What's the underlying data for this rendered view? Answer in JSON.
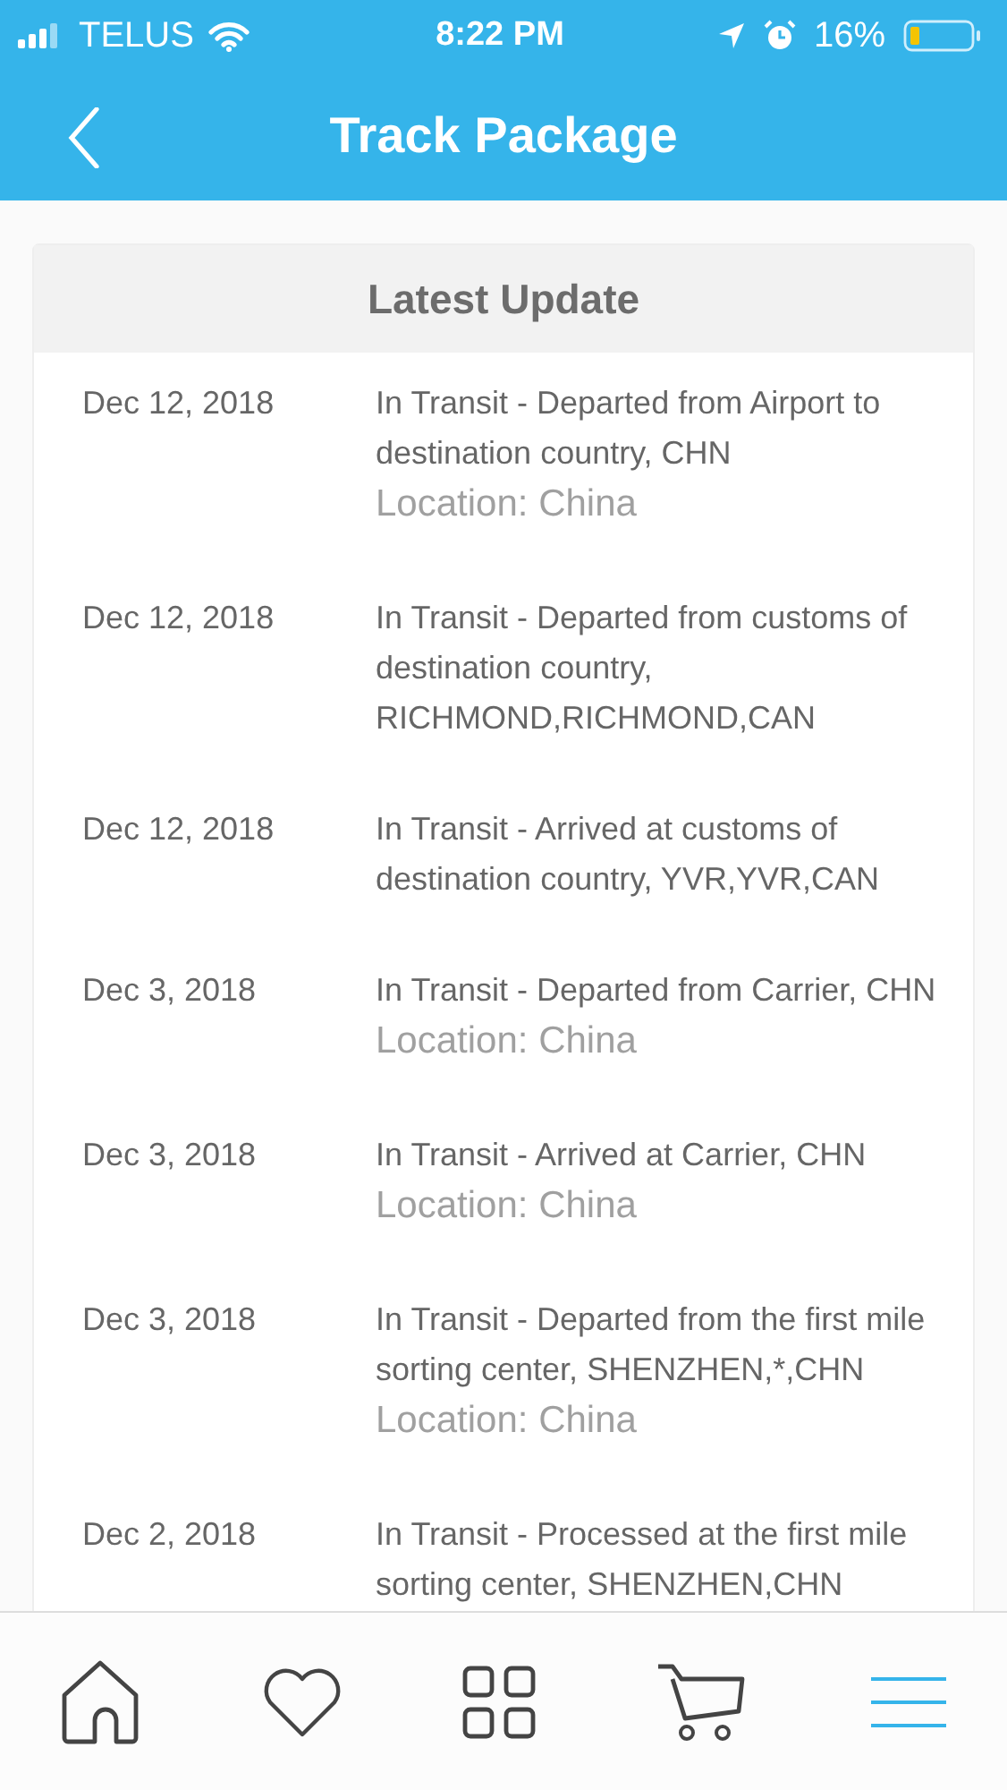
{
  "status_bar": {
    "carrier": "TELUS",
    "time": "8:22 PM",
    "battery": "16%"
  },
  "header": {
    "title": "Track Package"
  },
  "card": {
    "title": "Latest Update",
    "events": [
      {
        "date": "Dec 12, 2018",
        "description": "In Transit - Departed from Airport to destination country, CHN",
        "location": "Location: China"
      },
      {
        "date": "Dec 12, 2018",
        "description": "In Transit - Departed from customs of destination country, RICHMOND,RICHMOND,CAN"
      },
      {
        "date": "Dec 12, 2018",
        "description": "In Transit - Arrived at customs of destination country, YVR,YVR,CAN"
      },
      {
        "date": "Dec 3, 2018",
        "description": "In Transit - Departed from Carrier, CHN",
        "location": "Location: China"
      },
      {
        "date": "Dec 3, 2018",
        "description": "In Transit - Arrived at Carrier, CHN",
        "location": "Location: China"
      },
      {
        "date": "Dec 3, 2018",
        "description": "In Transit - Departed from the first mile sorting center, SHENZHEN,*,CHN",
        "location": "Location: China"
      },
      {
        "date": "Dec 2, 2018",
        "description": "In Transit - Processed at the first mile sorting center, SHENZHEN,CHN"
      }
    ]
  },
  "tab_bar": [
    {
      "kind": "home",
      "selected": false
    },
    {
      "kind": "favorites",
      "selected": false
    },
    {
      "kind": "categories",
      "selected": false
    },
    {
      "kind": "cart",
      "selected": false
    },
    {
      "kind": "menu",
      "selected": true
    }
  ]
}
